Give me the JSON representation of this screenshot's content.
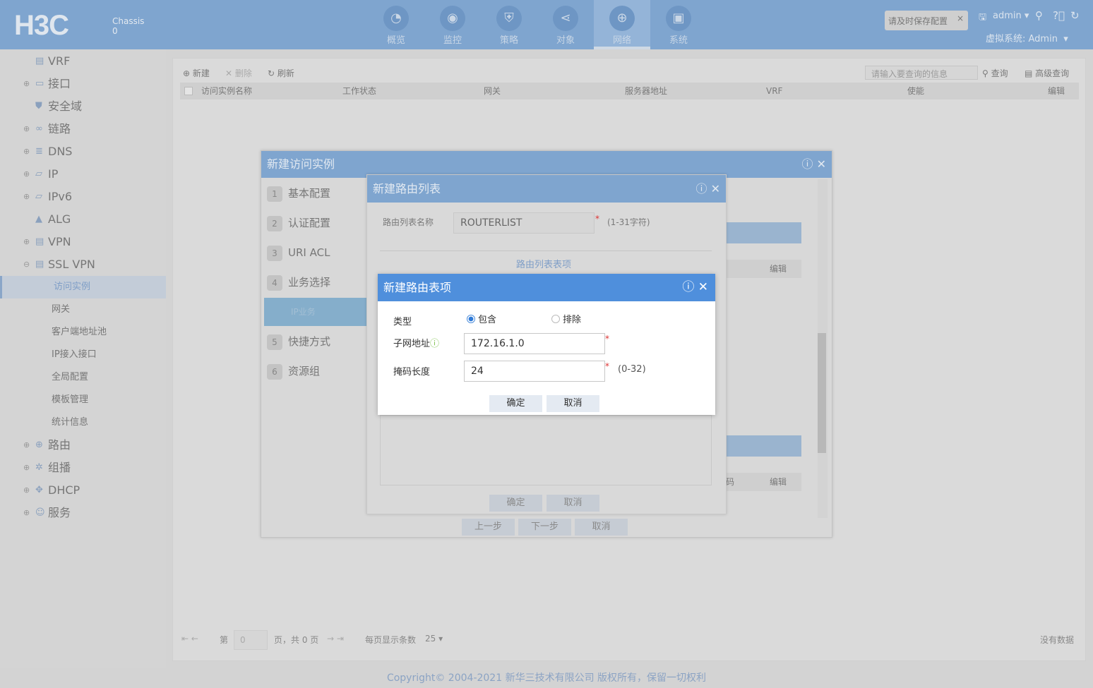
{
  "header": {
    "logo": "H3C",
    "chassis_label": "Chassis",
    "chassis_no": "0",
    "nav": [
      {
        "label": "概览",
        "icon": "gauge-icon"
      },
      {
        "label": "监控",
        "icon": "camera-icon"
      },
      {
        "label": "策略",
        "icon": "shield-icon"
      },
      {
        "label": "对象",
        "icon": "share-icon"
      },
      {
        "label": "网络",
        "icon": "globe-icon",
        "active": true
      },
      {
        "label": "系统",
        "icon": "monitor-icon"
      }
    ],
    "save_notice": "请及时保存配置",
    "user": "admin",
    "vsys": "虚拟系统: Admin"
  },
  "sidebar": {
    "items": [
      {
        "label": "VRF"
      },
      {
        "label": "接口"
      },
      {
        "label": "安全域"
      },
      {
        "label": "链路"
      },
      {
        "label": "DNS"
      },
      {
        "label": "IP"
      },
      {
        "label": "IPv6"
      },
      {
        "label": "ALG"
      },
      {
        "label": "VPN"
      },
      {
        "label": "SSL VPN"
      }
    ],
    "sub": [
      {
        "label": "访问实例",
        "selected": true
      },
      {
        "label": "网关"
      },
      {
        "label": "客户端地址池"
      },
      {
        "label": "IP接入接口"
      },
      {
        "label": "全局配置"
      },
      {
        "label": "模板管理"
      },
      {
        "label": "统计信息"
      }
    ],
    "items2": [
      {
        "label": "路由"
      },
      {
        "label": "组播"
      },
      {
        "label": "DHCP"
      },
      {
        "label": "服务"
      }
    ]
  },
  "toolbar": {
    "new": "新建",
    "delete": "删除",
    "refresh": "刷新",
    "search_placeholder": "请输入要查询的信息",
    "query": "查询",
    "advanced": "高级查询"
  },
  "table": {
    "columns": [
      "访问实例名称",
      "工作状态",
      "网关",
      "服务器地址",
      "VRF",
      "使能",
      "编辑"
    ]
  },
  "pager": {
    "page_prefix": "第",
    "page": "0",
    "page_suffix": "页，共 0 页",
    "per_page_label": "每页显示条数",
    "per_page": "25",
    "no_data": "没有数据"
  },
  "dialog1": {
    "title": "新建访问实例",
    "steps": [
      "基本配置",
      "认证配置",
      "URI ACL",
      "业务选择",
      "快捷方式",
      "资源组"
    ],
    "active_sub": "IP业务",
    "edit1": "编辑",
    "edit2": "编辑",
    "col_frag": "码",
    "prev": "上一步",
    "next": "下一步",
    "cancel": "取消"
  },
  "dialog2": {
    "title": "新建路由列表",
    "name_label": "路由列表名称",
    "name_value": "ROUTERLIST",
    "name_hint": "(1-31字符)",
    "section": "路由列表表项",
    "ok": "确定",
    "cancel": "取消"
  },
  "dialog3": {
    "title": "新建路由表项",
    "type_label": "类型",
    "type_include": "包含",
    "type_exclude": "排除",
    "type_selected": "包含",
    "subnet_label": "子网地址",
    "subnet_value": "172.16.1.0",
    "mask_label": "掩码长度",
    "mask_value": "24",
    "mask_hint": "(0-32)",
    "ok": "确定",
    "cancel": "取消"
  },
  "footer": "Copyright© 2004-2021 新华三技术有限公司 版权所有，保留一切权利"
}
